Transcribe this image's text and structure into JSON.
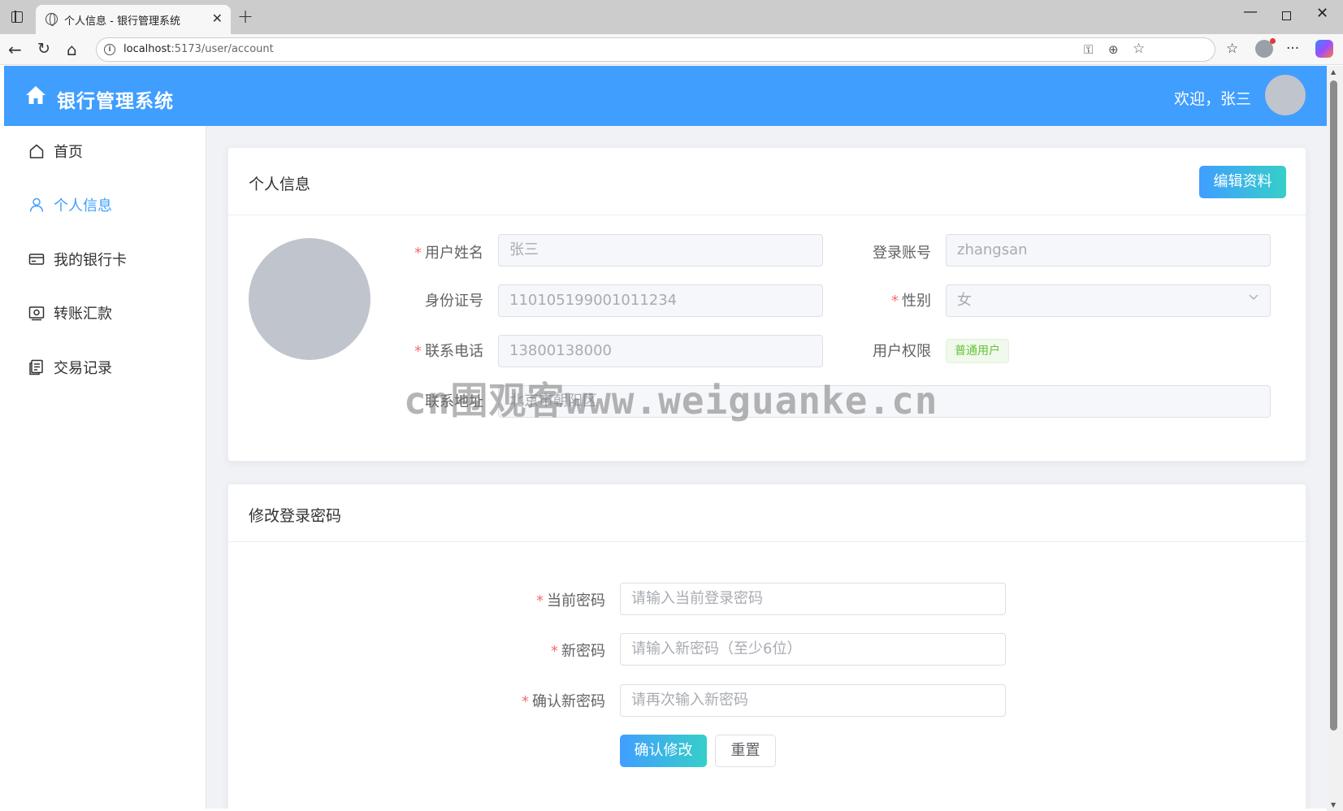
{
  "browser": {
    "tab_title": "个人信息 - 银行管理系统",
    "url_host": "localhost",
    "url_rest": ":5173/user/account"
  },
  "app": {
    "title": "银行管理系统",
    "welcome": "欢迎，张三",
    "brand_color": "#409eff"
  },
  "sidebar": {
    "items": [
      {
        "label": "首页",
        "icon": "home-icon"
      },
      {
        "label": "个人信息",
        "icon": "user-icon",
        "active": true
      },
      {
        "label": "我的银行卡",
        "icon": "card-icon"
      },
      {
        "label": "转账汇款",
        "icon": "transfer-icon"
      },
      {
        "label": "交易记录",
        "icon": "records-icon"
      }
    ]
  },
  "profile": {
    "title": "个人信息",
    "edit_label": "编辑资料",
    "fields": {
      "name": {
        "label": "用户姓名",
        "value": "张三"
      },
      "account": {
        "label": "登录账号",
        "value": "zhangsan"
      },
      "id_card": {
        "label": "身份证号",
        "value": "110105199001011234"
      },
      "gender": {
        "label": "性别",
        "value": "女"
      },
      "phone": {
        "label": "联系电话",
        "value": "13800138000"
      },
      "role": {
        "label": "用户权限",
        "value": "普通用户"
      },
      "address": {
        "label": "联系地址",
        "value": "北京市朝阳区"
      }
    }
  },
  "password": {
    "title": "修改登录密码",
    "current": {
      "label": "当前密码",
      "placeholder": "请输入当前登录密码"
    },
    "new": {
      "label": "新密码",
      "placeholder": "请输入新密码（至少6位）"
    },
    "confirm": {
      "label": "确认新密码",
      "placeholder": "请再次输入新密码"
    },
    "submit_label": "确认修改",
    "reset_label": "重置"
  },
  "watermark": "cn围观客www.weiguanke.cn"
}
